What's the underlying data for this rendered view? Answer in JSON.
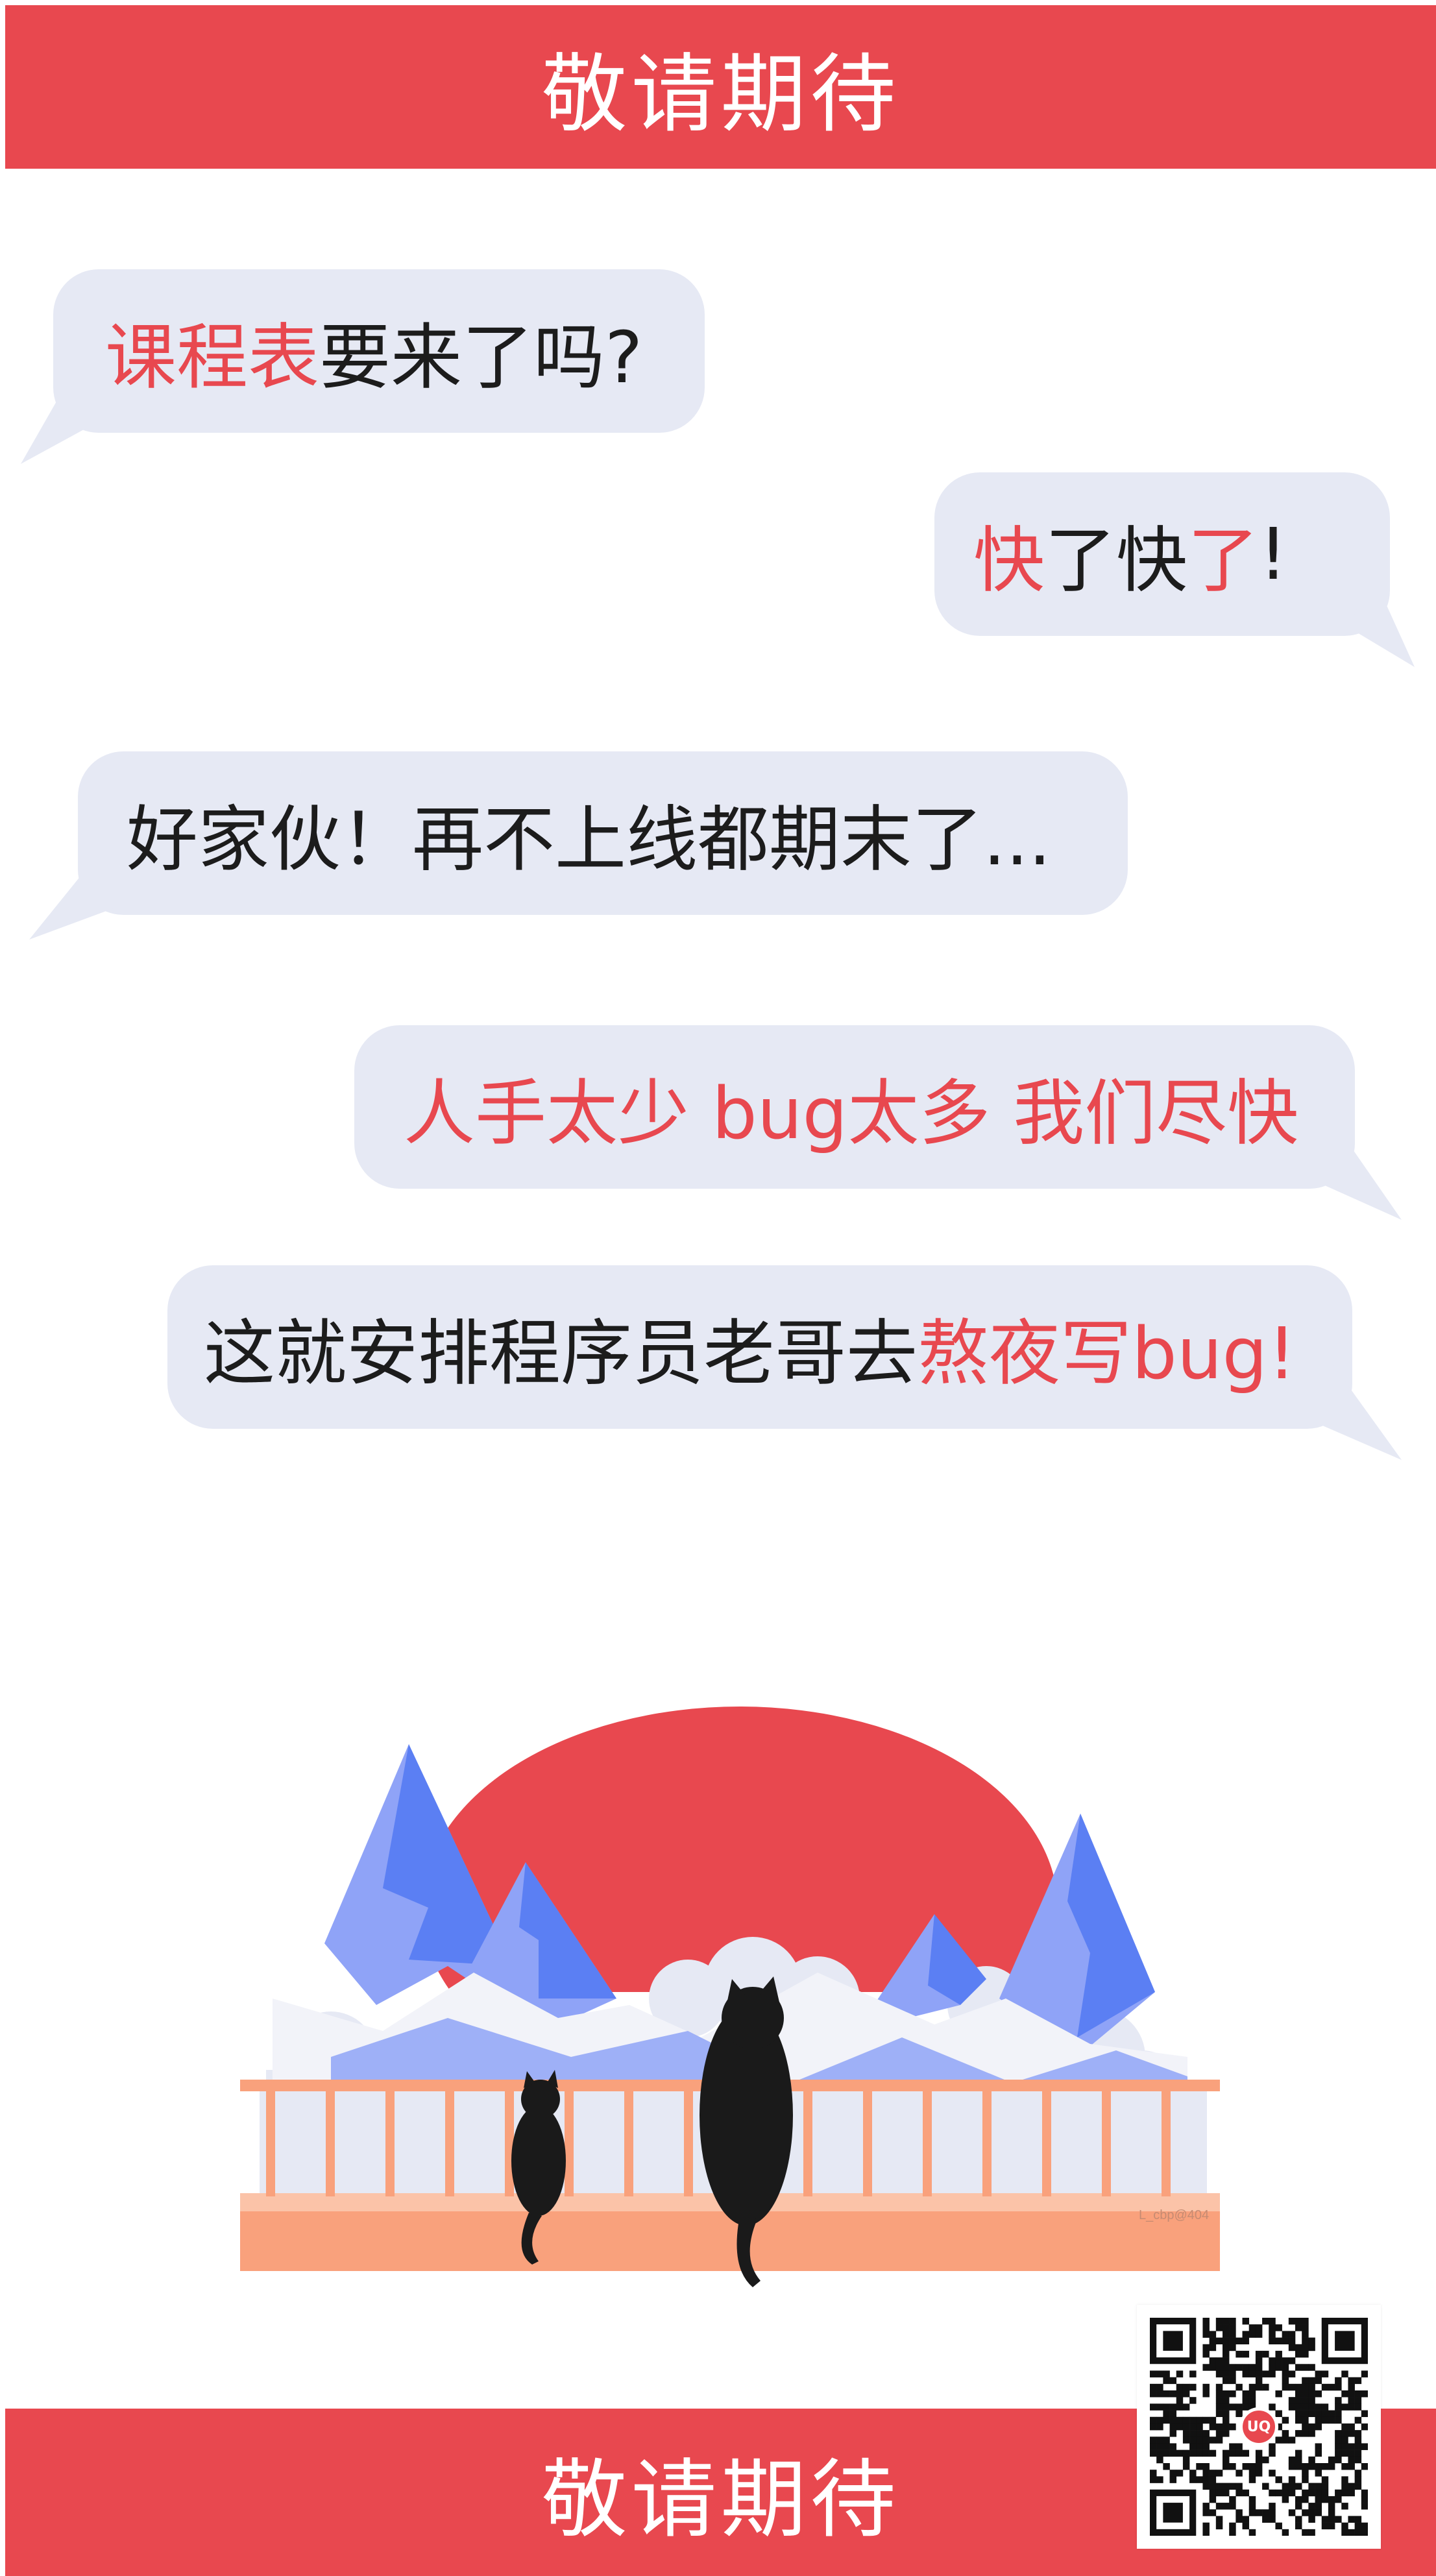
{
  "banner": {
    "top_text": "敬请期待",
    "bottom_text": "敬请期待"
  },
  "chat": {
    "msg1": {
      "part1": "课程表",
      "part2": "要来了吗?"
    },
    "msg2": {
      "part1": "快",
      "part2": "了快",
      "part3": "了",
      "part4": "!"
    },
    "msg3": {
      "text": "好家伙！再不上线都期末了..."
    },
    "msg4": {
      "text": "人手太少 bug太多 我们尽快"
    },
    "msg5": {
      "part1": "这就安排程序员老哥去",
      "part2": "熬夜写bug!"
    }
  },
  "illustration": {
    "credit": "L_cbp@404"
  },
  "qr": {
    "badge": "UQ"
  },
  "colors": {
    "accent_red": "#e8484f",
    "bubble_bg": "#e6e9f4",
    "mountain_blue": "#5b7ff3",
    "mountain_light": "#8fa3f7",
    "railing_orange": "#f9a17c",
    "text": "#1c1c1c"
  }
}
